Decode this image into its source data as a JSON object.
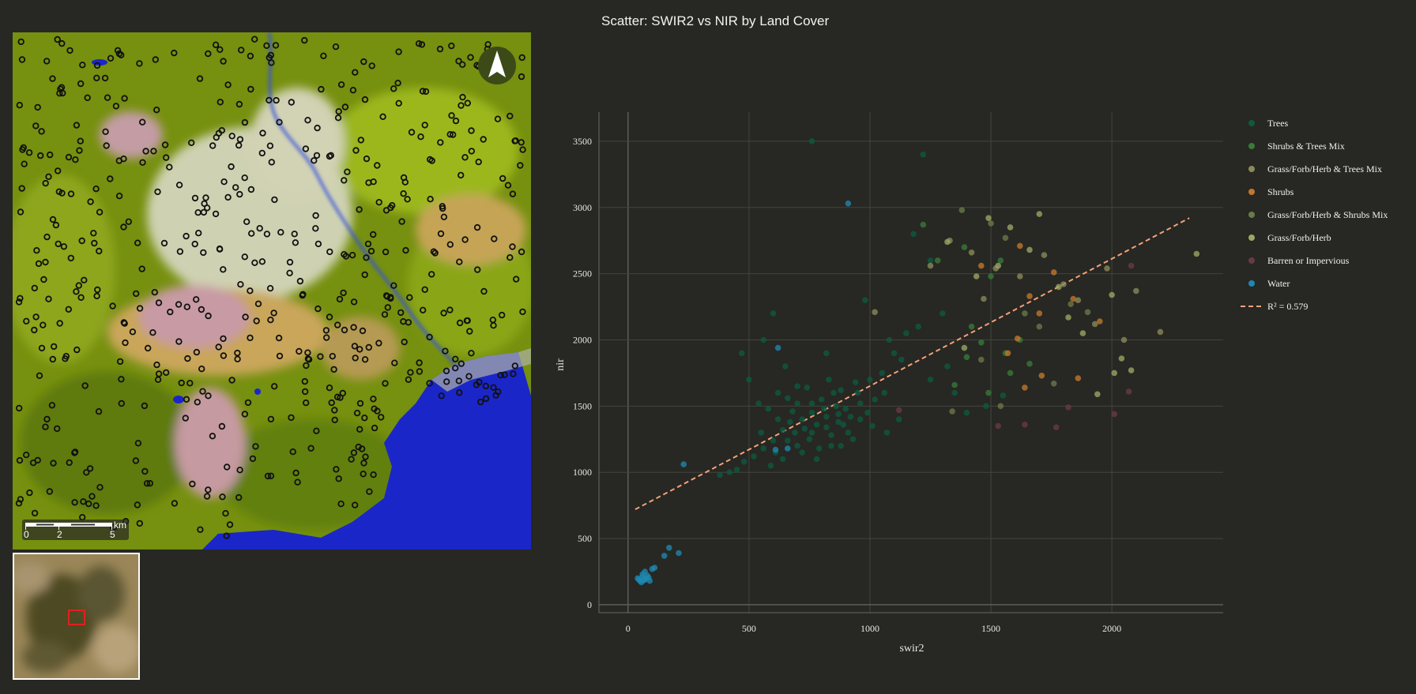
{
  "map": {
    "north_arrow_icon": "north-arrow-icon",
    "scale_bar": {
      "unit": "km",
      "labels": [
        "0",
        "2",
        "5"
      ]
    },
    "inset_icon": "locator-inset-map",
    "colors": {
      "vegetation": "#7a9314",
      "bright_vegetation": "#a8c81c",
      "dark_vegetation": "#5a7010",
      "bare_pink": "#c7a0a8",
      "bare_tan": "#c9a65a",
      "pale": "#c9ccae",
      "water": "#1b26c8",
      "river": "#3450e0",
      "sample_point": "#111111",
      "inset_box": "#e02020"
    }
  },
  "chart": {
    "title": "Scatter: SWIR2 vs NIR by Land Cover",
    "x_tick_labels": [
      "0",
      "500",
      "1000",
      "1500",
      "2000"
    ],
    "y_tick_labels": [
      "0",
      "500",
      "1000",
      "1500",
      "2000",
      "2500",
      "3000",
      "3500"
    ]
  },
  "chart_data": {
    "type": "scatter",
    "title": "Scatter: SWIR2 vs NIR by Land Cover",
    "xlabel": "swir2",
    "ylabel": "nir",
    "xlim": [
      -120,
      2460
    ],
    "ylim": [
      -60,
      3720
    ],
    "grid": true,
    "legend_position": "right",
    "series": [
      {
        "name": "Trees",
        "color": "#0d5a40",
        "points": [
          [
            780,
            1360
          ],
          [
            820,
            1420
          ],
          [
            690,
            1300
          ],
          [
            860,
            1500
          ],
          [
            750,
            1250
          ],
          [
            900,
            1480
          ],
          [
            640,
            1320
          ],
          [
            720,
            1400
          ],
          [
            800,
            1550
          ],
          [
            870,
            1380
          ],
          [
            600,
            1240
          ],
          [
            950,
            1600
          ],
          [
            560,
            1180
          ],
          [
            680,
            1460
          ],
          [
            760,
            1520
          ],
          [
            840,
            1280
          ],
          [
            920,
            1420
          ],
          [
            1000,
            1700
          ],
          [
            520,
            1120
          ],
          [
            480,
            1080
          ],
          [
            620,
            1400
          ],
          [
            700,
            1200
          ],
          [
            880,
            1620
          ],
          [
            960,
            1520
          ],
          [
            1050,
            1750
          ],
          [
            1100,
            1900
          ],
          [
            1150,
            2050
          ],
          [
            450,
            1020
          ],
          [
            420,
            1000
          ],
          [
            380,
            980
          ],
          [
            660,
            1560
          ],
          [
            740,
            1640
          ],
          [
            580,
            1480
          ],
          [
            830,
            1700
          ],
          [
            910,
            1300
          ],
          [
            990,
            1450
          ],
          [
            1060,
            1600
          ],
          [
            1130,
            1850
          ],
          [
            610,
            1150
          ],
          [
            550,
            1300
          ],
          [
            700,
            1650
          ],
          [
            790,
            1180
          ],
          [
            850,
            1600
          ],
          [
            760,
            1450
          ],
          [
            670,
            1380
          ],
          [
            730,
            1330
          ],
          [
            810,
            1480
          ],
          [
            890,
            1360
          ],
          [
            940,
            1680
          ],
          [
            1020,
            1550
          ],
          [
            1200,
            2100
          ],
          [
            1250,
            2600
          ],
          [
            1180,
            2800
          ],
          [
            760,
            3500
          ],
          [
            1220,
            3400
          ],
          [
            980,
            2300
          ],
          [
            1300,
            2200
          ],
          [
            1320,
            1800
          ],
          [
            1080,
            2000
          ],
          [
            470,
            1900
          ],
          [
            600,
            2200
          ],
          [
            1350,
            1600
          ],
          [
            1400,
            1450
          ],
          [
            1480,
            1500
          ],
          [
            1550,
            1580
          ],
          [
            1250,
            1700
          ],
          [
            1120,
            1400
          ],
          [
            1070,
            1300
          ],
          [
            500,
            1700
          ],
          [
            560,
            2000
          ],
          [
            650,
            1800
          ],
          [
            820,
            1900
          ],
          [
            720,
            1150
          ],
          [
            640,
            1100
          ],
          [
            590,
            1050
          ],
          [
            780,
            1100
          ],
          [
            840,
            1200
          ],
          [
            700,
            1520
          ],
          [
            620,
            1600
          ],
          [
            540,
            1520
          ],
          [
            880,
            1200
          ],
          [
            930,
            1250
          ],
          [
            960,
            1400
          ],
          [
            1010,
            1350
          ],
          [
            660,
            1240
          ],
          [
            760,
            1300
          ],
          [
            820,
            1340
          ],
          [
            870,
            1440
          ]
        ]
      },
      {
        "name": "Shrubs & Trees Mix",
        "color": "#3a7a3a",
        "points": [
          [
            1220,
            2870
          ],
          [
            1280,
            2600
          ],
          [
            1390,
            2700
          ],
          [
            1400,
            1870
          ],
          [
            1490,
            1600
          ],
          [
            1580,
            1750
          ],
          [
            1660,
            1820
          ],
          [
            1500,
            2480
          ],
          [
            1460,
            1980
          ],
          [
            1350,
            1660
          ],
          [
            1620,
            2000
          ],
          [
            1560,
            1900
          ],
          [
            1420,
            2100
          ],
          [
            1540,
            2600
          ]
        ]
      },
      {
        "name": "Grass/Forb/Herb & Trees Mix",
        "color": "#8a8a5a",
        "points": [
          [
            1020,
            2210
          ],
          [
            1250,
            2560
          ],
          [
            1330,
            2750
          ],
          [
            1420,
            2660
          ],
          [
            1520,
            2540
          ],
          [
            1620,
            2480
          ],
          [
            1720,
            2640
          ],
          [
            1800,
            2420
          ],
          [
            1860,
            2300
          ],
          [
            1930,
            2120
          ],
          [
            1980,
            2540
          ],
          [
            2050,
            2000
          ],
          [
            2100,
            2370
          ],
          [
            2200,
            2060
          ],
          [
            1470,
            2310
          ]
        ]
      },
      {
        "name": "Shrubs",
        "color": "#c2782a",
        "points": [
          [
            1620,
            2710
          ],
          [
            1660,
            2330
          ],
          [
            1700,
            2200
          ],
          [
            1760,
            2510
          ],
          [
            1840,
            2310
          ],
          [
            1950,
            2140
          ],
          [
            1570,
            1900
          ],
          [
            1640,
            1640
          ],
          [
            1710,
            1730
          ],
          [
            1860,
            1710
          ],
          [
            1460,
            2560
          ],
          [
            1610,
            2010
          ]
        ]
      },
      {
        "name": "Grass/Forb/Herb & Shrubs Mix",
        "color": "#6a7a4a",
        "points": [
          [
            1380,
            2980
          ],
          [
            1500,
            2880
          ],
          [
            1560,
            2770
          ],
          [
            1640,
            2200
          ],
          [
            1700,
            2100
          ],
          [
            1760,
            1670
          ],
          [
            1340,
            1460
          ],
          [
            1460,
            1850
          ],
          [
            1830,
            2270
          ],
          [
            1900,
            2210
          ],
          [
            1540,
            1500
          ]
        ]
      },
      {
        "name": "Grass/Forb/Herb",
        "color": "#9aa864",
        "points": [
          [
            1320,
            2740
          ],
          [
            1490,
            2920
          ],
          [
            1530,
            2560
          ],
          [
            1580,
            2850
          ],
          [
            1700,
            2950
          ],
          [
            1780,
            2400
          ],
          [
            1820,
            2170
          ],
          [
            1880,
            2050
          ],
          [
            1940,
            1590
          ],
          [
            2010,
            1750
          ],
          [
            2040,
            1860
          ],
          [
            2080,
            1770
          ],
          [
            2350,
            2650
          ],
          [
            2000,
            2340
          ],
          [
            1440,
            2480
          ],
          [
            1390,
            1940
          ],
          [
            1660,
            2680
          ]
        ]
      },
      {
        "name": "Barren or Impervious",
        "color": "#6a3a44",
        "points": [
          [
            1120,
            1470
          ],
          [
            1530,
            1350
          ],
          [
            1640,
            1360
          ],
          [
            1770,
            1340
          ],
          [
            1820,
            1490
          ],
          [
            2010,
            1440
          ],
          [
            2070,
            1610
          ],
          [
            2080,
            2560
          ]
        ]
      },
      {
        "name": "Water",
        "color": "#1e88b0",
        "points": [
          [
            40,
            200
          ],
          [
            50,
            180
          ],
          [
            60,
            210
          ],
          [
            70,
            190
          ],
          [
            80,
            220
          ],
          [
            55,
            170
          ],
          [
            65,
            185
          ],
          [
            75,
            200
          ],
          [
            45,
            190
          ],
          [
            85,
            205
          ],
          [
            90,
            180
          ],
          [
            60,
            230
          ],
          [
            70,
            250
          ],
          [
            100,
            270
          ],
          [
            110,
            280
          ],
          [
            150,
            370
          ],
          [
            170,
            430
          ],
          [
            210,
            390
          ],
          [
            230,
            1060
          ],
          [
            610,
            1170
          ],
          [
            660,
            1180
          ],
          [
            620,
            1940
          ],
          [
            910,
            3030
          ]
        ]
      }
    ],
    "trendline": {
      "name": "R² = 0.579",
      "color": "#f4a278",
      "x": [
        30,
        2320
      ],
      "y": [
        720,
        2920
      ]
    }
  }
}
